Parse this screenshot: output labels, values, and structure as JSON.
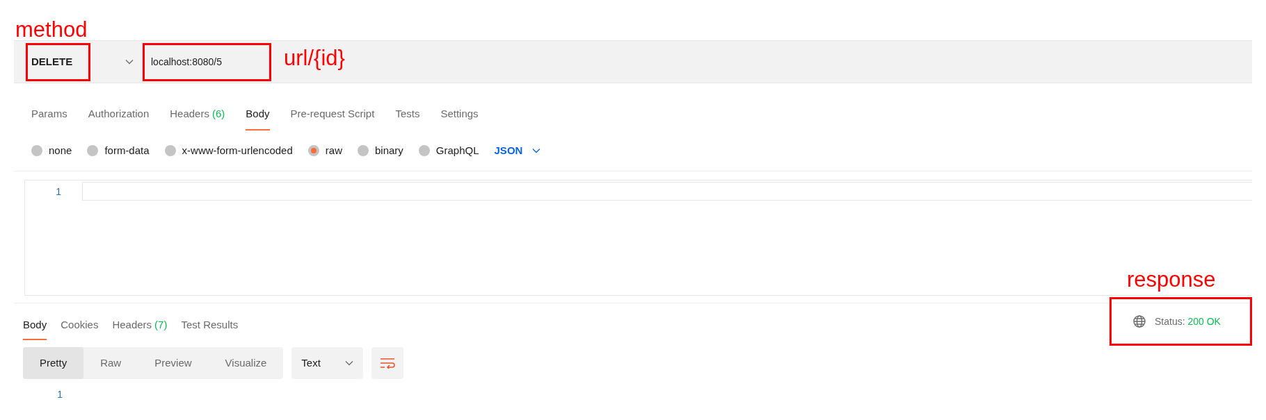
{
  "request": {
    "method": "DELETE",
    "method_note": "method",
    "url": "localhost:8080/5",
    "url_note": "url/{id}"
  },
  "request_tabs": [
    {
      "label": "Params",
      "selected": false
    },
    {
      "label": "Authorization",
      "selected": false
    },
    {
      "label": "Headers",
      "count": "(6)",
      "selected": false
    },
    {
      "label": "Body",
      "selected": true
    },
    {
      "label": "Pre-request Script",
      "selected": false
    },
    {
      "label": "Tests",
      "selected": false
    },
    {
      "label": "Settings",
      "selected": false
    }
  ],
  "body_types": [
    {
      "label": "none",
      "selected": false
    },
    {
      "label": "form-data",
      "selected": false
    },
    {
      "label": "x-www-form-urlencoded",
      "selected": false
    },
    {
      "label": "raw",
      "selected": true
    },
    {
      "label": "binary",
      "selected": false
    },
    {
      "label": "GraphQL",
      "selected": false
    }
  ],
  "body_format": "JSON",
  "editor": {
    "line_numbers": [
      "1"
    ]
  },
  "response_tabs": [
    {
      "label": "Body",
      "selected": true
    },
    {
      "label": "Cookies",
      "selected": false
    },
    {
      "label": "Headers",
      "count": "(7)",
      "selected": false
    },
    {
      "label": "Test Results",
      "selected": false
    }
  ],
  "status": {
    "note": "response",
    "label": "Status:",
    "value": "200 OK"
  },
  "view_modes": [
    {
      "label": "Pretty",
      "selected": true
    },
    {
      "label": "Raw",
      "selected": false
    },
    {
      "label": "Preview",
      "selected": false
    },
    {
      "label": "Visualize",
      "selected": false
    }
  ],
  "response_format": "Text",
  "response_lines": [
    "1"
  ]
}
